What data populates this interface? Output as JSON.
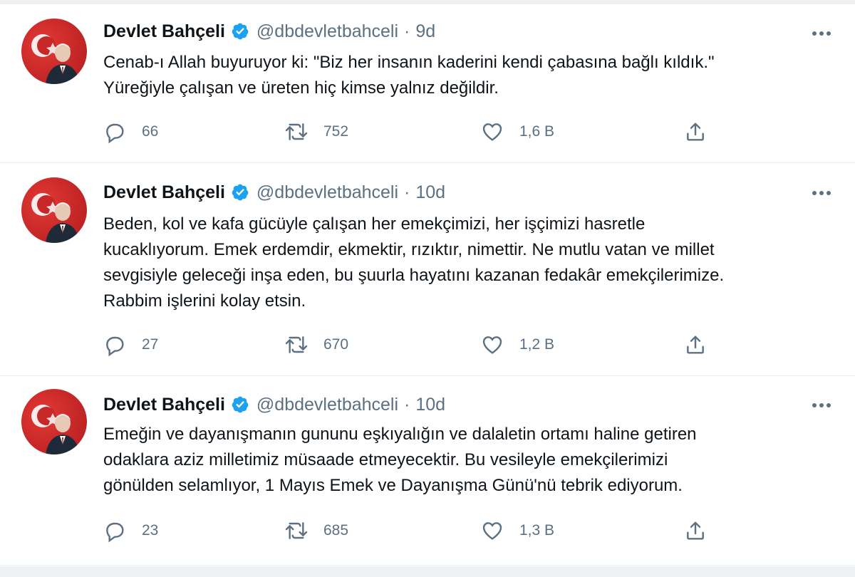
{
  "tweets": [
    {
      "author_name": "Devlet Bahçeli",
      "handle": "@dbdevletbahceli",
      "separator": "·",
      "time": "9d",
      "text_lines": [
        "Cenab-ı Allah buyuruyor ki: \"Biz her insanın kaderini kendi çabasına bağlı kıldık.\"",
        "Yüreğiyle çalışan ve üreten hiç kimse yalnız değildir."
      ],
      "replies": "66",
      "retweets": "752",
      "likes": "1,6 B"
    },
    {
      "author_name": "Devlet Bahçeli",
      "handle": "@dbdevletbahceli",
      "separator": "·",
      "time": "10d",
      "text_lines": [
        "Beden, kol ve kafa gücüyle çalışan her emekçimizi, her işçimizi hasretle",
        "kucaklıyorum. Emek erdemdir, ekmektir, rızıktır, nimettir. Ne mutlu vatan ve millet",
        "sevgisiyle geleceği inşa eden, bu şuurla hayatını kazanan fedakâr emekçilerimize.",
        "Rabbim işlerini kolay etsin."
      ],
      "replies": "27",
      "retweets": "670",
      "likes": "1,2 B"
    },
    {
      "author_name": "Devlet Bahçeli",
      "handle": "@dbdevletbahceli",
      "separator": "·",
      "time": "10d",
      "text_lines": [
        "Emeğin ve dayanışmanın gununu eşkıyalığın ve dalaletin ortamı haline getiren",
        "odaklara aziz milletimiz müsaade etmeyecektir. Bu vesileyle emekçilerimizi",
        "gönülden selamlıyor, 1 Mayıs Emek ve Dayanışma Günü'nü tebrik ediyorum."
      ],
      "replies": "23",
      "retweets": "685",
      "likes": "1,3 B"
    }
  ],
  "icons": {
    "verified": "verified-badge-icon",
    "more": "more-options-icon",
    "reply": "reply-icon",
    "retweet": "retweet-icon",
    "like": "like-icon",
    "share": "share-icon"
  },
  "colors": {
    "verified_blue": "#1da1f2",
    "muted_text": "#5b7083",
    "avatar_red": "#c62828"
  }
}
